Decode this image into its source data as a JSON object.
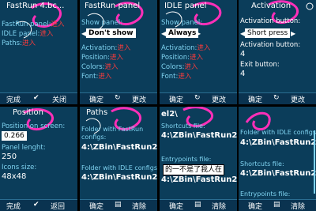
{
  "panels": [
    {
      "title": "FastRun 4.bc...",
      "rows": [
        {
          "label": "FastRun panel:",
          "value": "进入"
        },
        {
          "label": "IDLE panel:",
          "value": "进入"
        },
        {
          "label": "Paths:",
          "value": "进入"
        }
      ],
      "soft_left": "完成",
      "soft_right": "关闭"
    },
    {
      "title": "FastRun panel",
      "rows": [
        {
          "label": "Show panel:",
          "value": ""
        },
        {
          "label": "Activation:",
          "value": "进入"
        },
        {
          "label": "Position:",
          "value": "进入"
        },
        {
          "label": "Colors:",
          "value": "进入"
        },
        {
          "label": "Font:",
          "value": "进入"
        }
      ],
      "selector": "Don't show",
      "soft_left": "确定",
      "soft_right": "更改"
    },
    {
      "title": "IDLE panel",
      "rows": [
        {
          "label": "Show panel:",
          "value": ""
        },
        {
          "label": "Activation:",
          "value": "进入"
        },
        {
          "label": "Position:",
          "value": "进入"
        },
        {
          "label": "Colors:",
          "value": "进入"
        },
        {
          "label": "Font:",
          "value": "进入"
        }
      ],
      "selector": "Always",
      "soft_left": "确定",
      "soft_right": "更改"
    },
    {
      "title": "Activation",
      "rows": [
        {
          "label": "Activation button:",
          "value": ""
        },
        {
          "label": "4",
          "value": ""
        },
        {
          "label": "Exit button:",
          "value": ""
        },
        {
          "label": "4",
          "value": ""
        }
      ],
      "selector": "Short press",
      "soft_left": "确定",
      "soft_right": "更改"
    },
    {
      "title": "Position",
      "rows": [
        {
          "label": "Position on screen:",
          "value": ""
        },
        {
          "label": "0.266",
          "value": ""
        },
        {
          "label": "Panel lenght:",
          "value": ""
        },
        {
          "label": "250",
          "value": ""
        },
        {
          "label": "Icons size:",
          "value": ""
        },
        {
          "label": "48x48",
          "value": ""
        }
      ],
      "soft_left": "完成",
      "soft_right": "返回"
    },
    {
      "title": "Paths",
      "rows": [
        {
          "label": "Folder with FastRun configs:",
          "value": ""
        },
        {
          "label": "4:\\ZBin\\FastRun2\\panel1\\",
          "value": ""
        },
        {
          "label": "Folder with IDLE configs:",
          "value": ""
        },
        {
          "label": "4:\\ZBin\\FastRun2\\panel2\\",
          "value": ""
        }
      ],
      "soft_left": "确定",
      "soft_right": "清除"
    },
    {
      "title": "Paths",
      "rows": [
        {
          "label": "el2\\",
          "value": ""
        },
        {
          "label": "Shortcuts file:",
          "value": ""
        },
        {
          "label": "4:\\ZBin\\FastRun2\\shortcuts.txt",
          "value": ""
        },
        {
          "label": "Entrypoints file:",
          "value": ""
        },
        {
          "label": "4:\\ZBin\\FastRun2\\entrypoints.txt",
          "value": ""
        }
      ],
      "tooltip": "的一不是了我人在",
      "soft_left": "确定",
      "soft_right": "清除"
    },
    {
      "title": "Paths",
      "rows": [
        {
          "label": "Folder with IDLE configs:",
          "value": ""
        },
        {
          "label": "4:\\ZBin\\FastRun2\\panel2\\",
          "value": ""
        },
        {
          "label": "Shortcuts file:",
          "value": ""
        },
        {
          "label": "4:\\ZBin\\FastRun2\\shortcuts.txt",
          "value": ""
        },
        {
          "label": "Entrypoints file:",
          "value": ""
        }
      ],
      "soft_left": "确定",
      "soft_right": "清除"
    }
  ],
  "colors": {
    "panel_bg": "#0b3d5a",
    "label": "#7fd3f0",
    "value": "#ff3b3b",
    "swirl": "#ff2fb8"
  }
}
